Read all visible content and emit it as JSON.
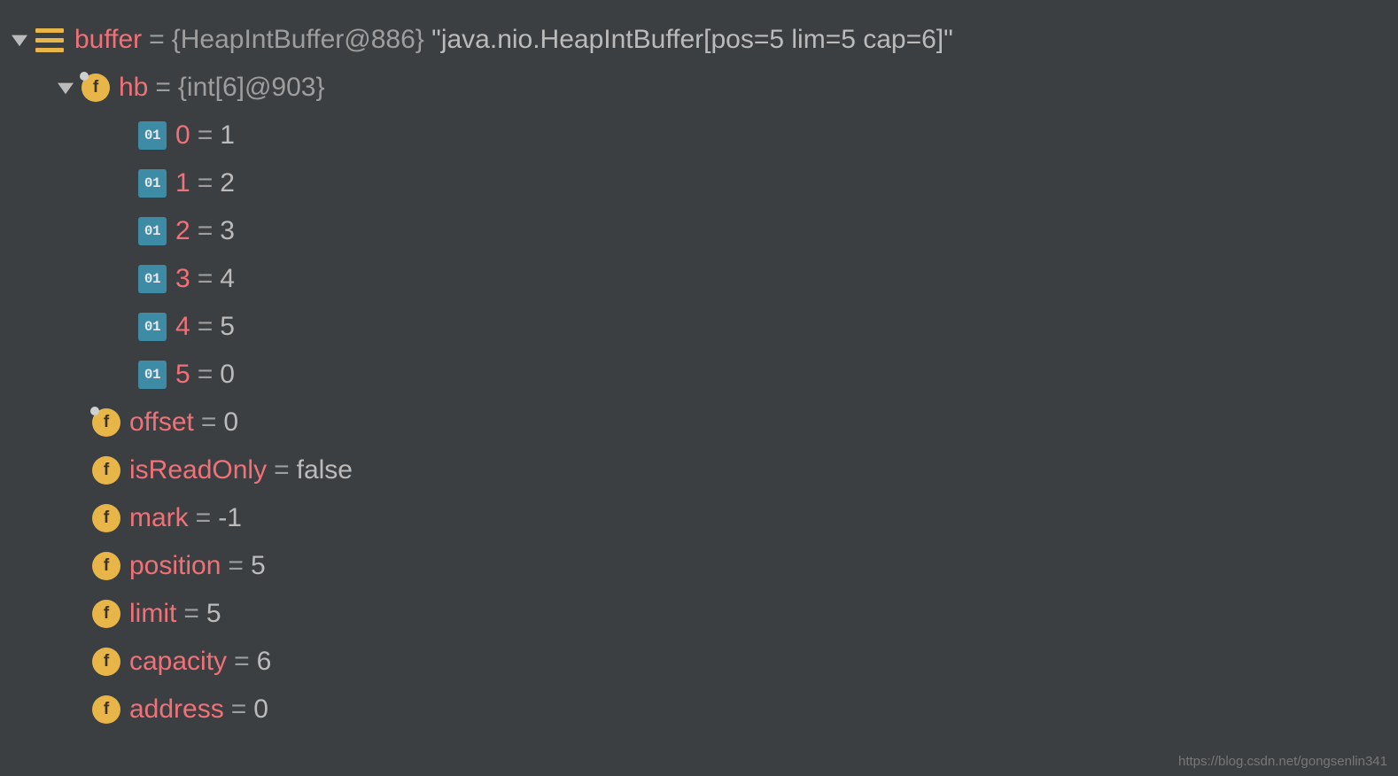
{
  "buffer": {
    "name": "buffer",
    "type": "{HeapIntBuffer@886}",
    "toString": "\"java.nio.HeapIntBuffer[pos=5 lim=5 cap=6]\"",
    "hb": {
      "name": "hb",
      "type": "{int[6]@903}",
      "items": [
        {
          "idx": "0",
          "val": "1"
        },
        {
          "idx": "1",
          "val": "2"
        },
        {
          "idx": "2",
          "val": "3"
        },
        {
          "idx": "3",
          "val": "4"
        },
        {
          "idx": "4",
          "val": "5"
        },
        {
          "idx": "5",
          "val": "0"
        }
      ]
    },
    "offset": {
      "name": "offset",
      "val": "0"
    },
    "isReadOnly": {
      "name": "isReadOnly",
      "val": "false"
    },
    "mark": {
      "name": "mark",
      "val": "-1"
    },
    "position": {
      "name": "position",
      "val": "5"
    },
    "limit": {
      "name": "limit",
      "val": "5"
    },
    "capacity": {
      "name": "capacity",
      "val": "6"
    },
    "address": {
      "name": "address",
      "val": "0"
    }
  },
  "eq": "=",
  "intIconLabel": "01",
  "fieldIconLabel": "f",
  "watermark": "https://blog.csdn.net/gongsenlin341"
}
